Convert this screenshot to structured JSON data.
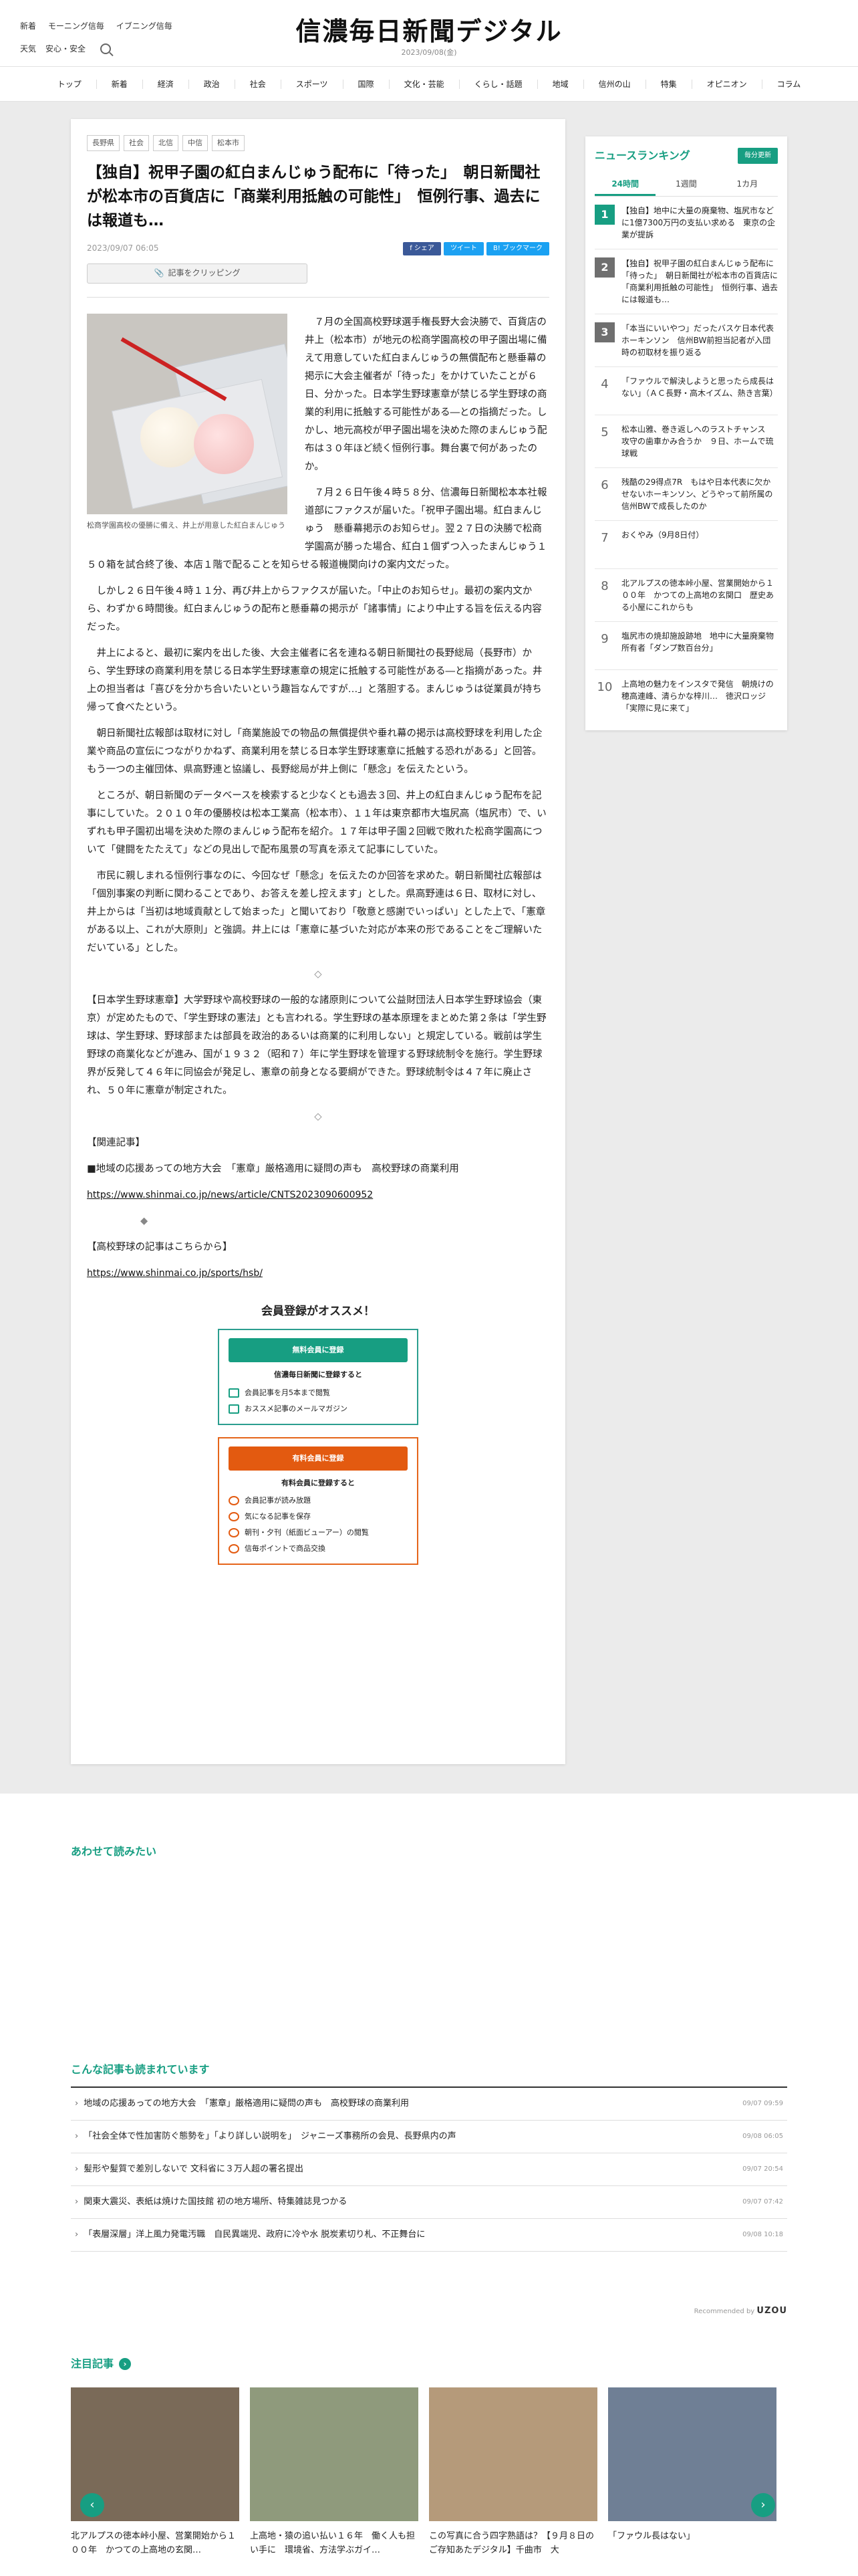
{
  "header": {
    "top_links": [
      "新着",
      "モーニング信毎",
      "イブニング信毎"
    ],
    "top_links2": [
      "天気",
      "安心・安全"
    ],
    "logo": "信濃毎日新聞デジタル",
    "date": "2023/09/08(金)"
  },
  "nav": [
    "トップ",
    "新着",
    "経済",
    "政治",
    "社会",
    "スポーツ",
    "国際",
    "文化・芸能",
    "くらし・話題",
    "地域",
    "信州の山",
    "特集",
    "オピニオン",
    "コラム"
  ],
  "article": {
    "tags": [
      "長野県",
      "社会",
      "北信",
      "中信",
      "松本市"
    ],
    "headline": "【独自】祝甲子園の紅白まんじゅう配布に「待った」　朝日新聞社が松本市の百貨店に「商業利用抵触の可能性」　恒例行事、過去には報道も…",
    "date": "2023/09/07 06:05",
    "share_fb": "f シェア",
    "share_tw": "ツイート",
    "share_hb": "B! ブックマーク",
    "clip": "記事をクリッピング",
    "caption": "松商学園高校の優勝に備え、井上が用意した紅白まんじゅう",
    "paragraphs_float": [
      "７月の全国高校野球選手権長野大会決勝で、百貨店の井上（松本市）が地元の松商学園高校の甲子園出場に備えて用意していた紅白まんじゅうの無償配布と懸垂幕の掲示に大会主催者が「待った」をかけていたことが６日、分かった。日本学生野球憲章が禁じる学生野球の商業的利用に抵触する可能性がある―との指摘だった。しかし、地元高校が甲子園出場を決めた際のまんじゅう配布は３０年ほど続く恒例行事。舞台裏で何があったのか。",
      "７月２６日午後４時５８分、信濃毎日新聞松本本社報道部にファクスが届いた。「祝甲子園出場。紅白まんじゅう　懸垂幕掲示のお知らせ」。翌２７日の決勝で松商学園高が勝った場合、紅白１個ずつ入ったまんじゅう１５０箱を試合終了後、本店１階で配ることを知らせる報道機関向けの案内文だった。",
      "しかし２６日午後４時１１分、再び井上からファクスが届いた。「中止のお知らせ」。最初の案内文から、わずか６時間後。紅白まんじゅうの配布と懸垂幕の掲示が「諸事情」により中止する旨を伝える内容だった。"
    ],
    "paragraphs": [
      "井上によると、最初に案内を出した後、大会主催者に名を連ねる朝日新聞社の長野総局（長野市）から、学生野球の商業利用を禁じる日本学生野球憲章の規定に抵触する可能性がある―と指摘があった。井上の担当者は「喜びを分かち合いたいという趣旨なんですが…」と落胆する。まんじゅうは従業員が持ち帰って食べたという。",
      "朝日新聞社広報部は取材に対し「商業施設での物品の無償提供や垂れ幕の掲示は高校野球を利用した企業や商品の宣伝につながりかねず、商業利用を禁じる日本学生野球憲章に抵触する恐れがある」と回答。もう一つの主催団体、県高野連と協議し、長野総局が井上側に「懸念」を伝えたという。",
      "ところが、朝日新聞のデータベースを検索すると少なくとも過去３回、井上の紅白まんじゅう配布を記事にしていた。２０１０年の優勝校は松本工業高（松本市）、１１年は東京都市大塩尻高（塩尻市）で、いずれも甲子園初出場を決めた際のまんじゅう配布を紹介。１７年は甲子園２回戦で敗れた松商学園高について「健闘をたたえて」などの見出しで配布風景の写真を添えて記事にしていた。",
      "市民に親しまれる恒例行事なのに、今回なぜ「懸念」を伝えたのか回答を求めた。朝日新聞社広報部は「個別事案の判断に関わることであり、お答えを差し控えます」とした。県高野連は６日、取材に対し、井上からは「当初は地域貢献として始まった」と聞いており「敬意と感謝でいっぱい」とした上で、「憲章がある以上、これが大原則」と強調。井上には「憲章に基づいた対応が本来の形であることをご理解いただいている」とした。"
    ],
    "diamond": "◇",
    "explainer": "【日本学生野球憲章】大学野球や高校野球の一般的な諸原則について公益財団法人日本学生野球協会（東京）が定めたもので、「学生野球の憲法」とも言われる。学生野球の基本原理をまとめた第２条は「学生野球は、学生野球、野球部または部員を政治的あるいは商業的に利用しない」と規定している。戦前は学生野球の商業化などが進み、国が１９３２（昭和７）年に学生野球を管理する野球統制令を施行。学生野球界が反発して４６年に同協会が発足し、憲章の前身となる要綱ができた。野球統制令は４７年に廃止され、５０年に憲章が制定された。",
    "related_head": "【関連記事】",
    "related_text": "■地域の応援あっての地方大会　「憲章」厳格適用に疑問の声も　高校野球の商業利用",
    "related_url": "https://www.shinmai.co.jp/news/article/CNTS2023090600952",
    "diamond2": "◆",
    "hsb_head": "【高校野球の記事はこちらから】",
    "hsb_url": "https://www.shinmai.co.jp/sports/hsb/"
  },
  "register": {
    "title": "会員登録がオススメ！",
    "free_btn": "無料会員に登録",
    "free_sub": "信濃毎日新聞に登録すると",
    "free_items": [
      "会員記事を月5本まで閲覧",
      "おススメ記事のメールマガジン"
    ],
    "paid_btn": "有料会員に登録",
    "paid_sub": "有料会員に登録すると",
    "paid_items": [
      "会員記事が読み放題",
      "気になる記事を保存",
      "朝刊・夕刊（紙面ビューアー）の閲覧",
      "信毎ポイントで商品交換"
    ]
  },
  "ranking": {
    "title": "ニュースランキング",
    "badge": "毎分更新",
    "tabs": [
      "24時間",
      "1週間",
      "1カ月"
    ],
    "items": [
      {
        "num": "1",
        "text": "【独自】地中に大量の廃棄物、塩尻市などに1億7300万円の支払い求める　東京の企業が提訴"
      },
      {
        "num": "2",
        "text": "【独自】祝甲子園の紅白まんじゅう配布に「待った」　朝日新聞社が松本市の百貨店に「商業利用抵触の可能性」　恒例行事、過去には報道も…"
      },
      {
        "num": "3",
        "text": "「本当にいいやつ」だったバスケ日本代表ホーキンソン　信州BW前担当記者が入団時の初取材を振り返る"
      },
      {
        "num": "4",
        "text": "「ファウルで解決しようと思ったら成長はない」（ＡＣ長野・高木イズム、熱き言葉）"
      },
      {
        "num": "5",
        "text": "松本山雅、巻き返しへのラストチャンス　攻守の歯車かみ合うか　９日、ホームで琉球戦"
      },
      {
        "num": "6",
        "text": "残酷の29得点7R　もはや日本代表に欠かせないホーキンソン、どうやって前所属の信州BWで成長したのか"
      },
      {
        "num": "7",
        "text": "おくやみ（9月8日付）"
      },
      {
        "num": "8",
        "text": "北アルプスの徳本峠小屋、営業開始から１００年　かつての上高地の玄関口　歴史ある小屋にこれからも"
      },
      {
        "num": "9",
        "text": "塩尻市の焼却施設跡地　地中に大量廃棄物　所有者「ダンプ数百台分」"
      },
      {
        "num": "10",
        "text": "上高地の魅力をインスタで発信　朝焼けの穂高連峰、清らかな梓川…　徳沢ロッジ「実際に見に来て」"
      }
    ]
  },
  "also_read": "あわせて読みたい",
  "recommended": {
    "title": "こんな記事も読まれています",
    "items": [
      {
        "text": "地域の応援あっての地方大会　「憲章」厳格適用に疑問の声も　高校野球の商業利用",
        "date": "09/07 09:59"
      },
      {
        "text": "「社会全体で性加害防ぐ態勢を」「より詳しい説明を」　ジャニーズ事務所の会見、長野県内の声",
        "date": "09/08 06:05"
      },
      {
        "text": "髪形や髪質で差別しないで 文科省に３万人超の署名提出",
        "date": "09/07 20:54"
      },
      {
        "text": "関東大震災、表紙は焼けた国技館 初の地方場所、特集雑誌見つかる",
        "date": "09/07 07:42"
      },
      {
        "text": "「表層深層」洋上風力発電汚職　自民異端児、政府に冷や水 脱炭素切り札、不正舞台に",
        "date": "09/08 10:18"
      }
    ],
    "by_label": "Recommended by",
    "by_brand": "UZOU"
  },
  "featured": {
    "title": "注目記事",
    "arrow": "›",
    "prev": "‹",
    "next": "›",
    "slides": [
      {
        "text": "北アルプスの徳本峠小屋、営業開始から１００年　かつての上高地の玄関…",
        "color": "#7a6a58"
      },
      {
        "text": "上高地・猿の追い払い１６年　働く人も担い手に　環境省、方法学ぶガイ…",
        "color": "#8f9a7c"
      },
      {
        "text": "この写真に合う四字熟語は？【９月８日のご存知あたデジタル】千曲市　大",
        "color": "#b59a7a"
      },
      {
        "text": "「ファウル長はない」",
        "color": "#6f7f95"
      }
    ]
  }
}
